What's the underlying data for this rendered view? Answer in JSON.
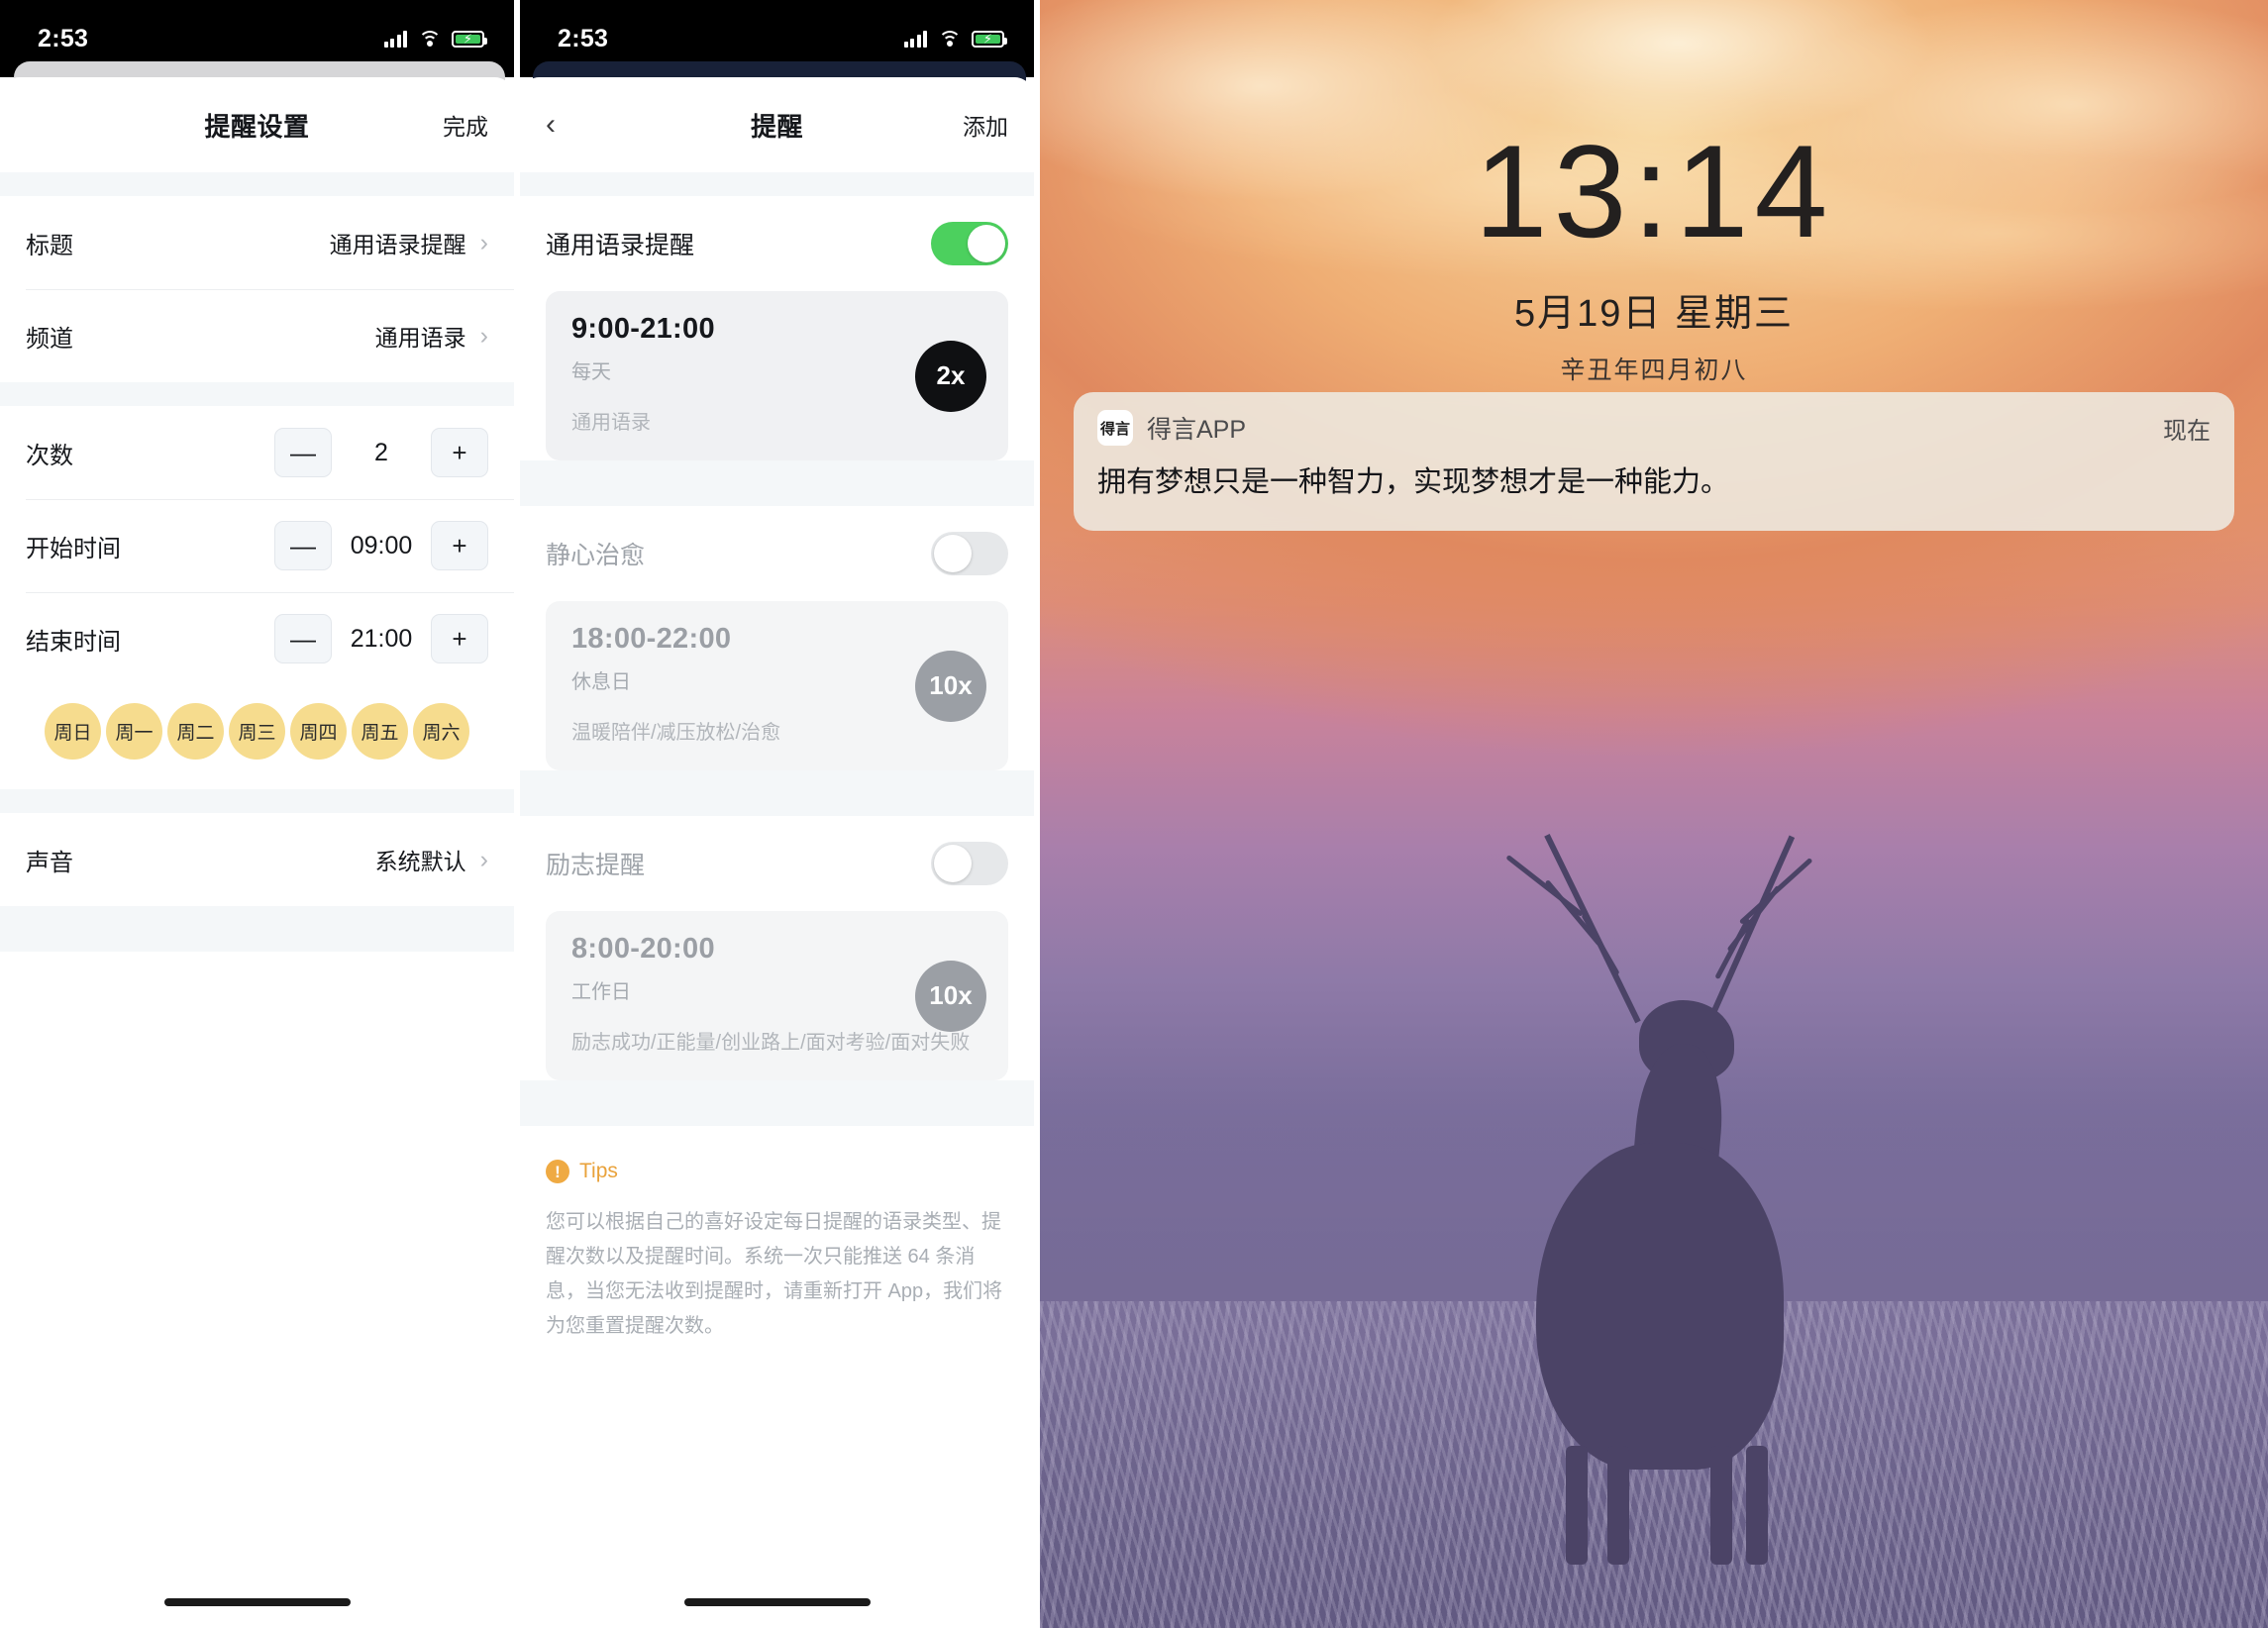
{
  "panel1": {
    "status": {
      "time": "2:53"
    },
    "nav": {
      "title": "提醒设置",
      "done": "完成"
    },
    "rows": [
      {
        "label": "标题",
        "value": "通用语录提醒"
      },
      {
        "label": "频道",
        "value": "通用语录"
      }
    ],
    "steppers": [
      {
        "label": "次数",
        "minus": "—",
        "value": "2",
        "plus": "+"
      },
      {
        "label": "开始时间",
        "minus": "—",
        "value": "09:00",
        "plus": "+"
      },
      {
        "label": "结束时间",
        "minus": "—",
        "value": "21:00",
        "plus": "+"
      }
    ],
    "days": [
      "周日",
      "周一",
      "周二",
      "周三",
      "周四",
      "周五",
      "周六"
    ],
    "sound": {
      "label": "声音",
      "value": "系统默认"
    }
  },
  "panel2": {
    "status": {
      "time": "2:53"
    },
    "nav": {
      "back": "‹",
      "title": "提醒",
      "add": "添加"
    },
    "reminders": [
      {
        "title": "通用语录提醒",
        "enabled": true,
        "time": "9:00-21:00",
        "freq": "每天",
        "tags": "通用语录",
        "count": "2x"
      },
      {
        "title": "静心治愈",
        "enabled": false,
        "time": "18:00-22:00",
        "freq": "休息日",
        "tags": "温暖陪伴/减压放松/治愈",
        "count": "10x"
      },
      {
        "title": "励志提醒",
        "enabled": false,
        "time": "8:00-20:00",
        "freq": "工作日",
        "tags": "励志成功/正能量/创业路上/面对考验/面对失败",
        "count": "10x"
      }
    ],
    "tips": {
      "label": "Tips",
      "icon": "!",
      "body": "您可以根据自己的喜好设定每日提醒的语录类型、提醒次数以及提醒时间。系统一次只能推送 64 条消息，当您无法收到提醒时，请重新打开 App，我们将为您重置提醒次数。"
    }
  },
  "panel3": {
    "clock": "13:14",
    "date": "5月19日  星期三",
    "lunar": "辛丑年四月初八",
    "notification": {
      "app_icon_text": "得言",
      "app_name": "得言APP",
      "when": "现在",
      "body": "拥有梦想只是一种智力，实现梦想才是一种能力。"
    }
  },
  "colors": {
    "accent_yellow": "#f6dc8e",
    "switch_on": "#4cd05e",
    "badge_dark": "#0f1012",
    "badge_grey": "#9b9fa5",
    "tips_orange": "#e9a23b"
  }
}
